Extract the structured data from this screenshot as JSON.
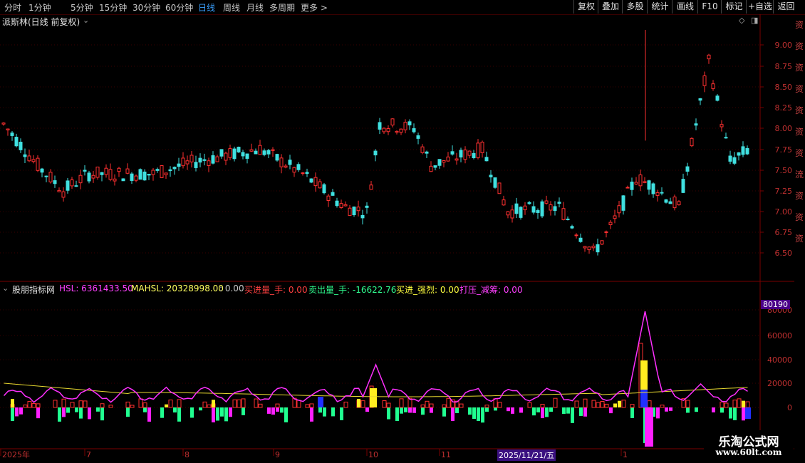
{
  "toolbar": {
    "periods": [
      "分时",
      "1分钟",
      "5分钟",
      "15分钟",
      "30分钟",
      "60分钟",
      "日线",
      "周线",
      "月线",
      "多周期",
      "更多 >"
    ],
    "active_period": "日线",
    "right_buttons": [
      "复权",
      "叠加",
      "多股",
      "统计",
      "画线",
      "F10",
      "标记",
      "+自选",
      "返回"
    ]
  },
  "main_panel": {
    "title": "派斯林(日线 前复权)",
    "y_ticks": [
      "9.00",
      "8.75",
      "8.50",
      "8.25",
      "8.00",
      "7.75",
      "7.50",
      "7.25",
      "7.00",
      "6.75",
      "6.50"
    ]
  },
  "indicator": {
    "name": "股朋指标网",
    "hsl_label": "HSL: 6361433.50",
    "mahsl_label": "MAHSL: 20328998.00",
    "extra_label": ": 0.00",
    "buy_label": "买进量_手: 0.00",
    "sell_label": "卖出量_手: -16622.76",
    "strong_label": "买进_强烈: 0.00",
    "press_label": "打压_减筹: 0.00",
    "current_value": "80190",
    "y_ticks": [
      "80000",
      "60000",
      "40000",
      "20000",
      "0"
    ]
  },
  "date_axis": {
    "labels": [
      "2025年",
      "7",
      "8",
      "9",
      "10",
      "11",
      "1"
    ],
    "cursor_date": "2025/11/21/五"
  },
  "watermark": {
    "line1": "乐淘公式网",
    "line2": "www.60lt.com"
  },
  "right_strip_chars": "资资资资资资资流资资资"
}
